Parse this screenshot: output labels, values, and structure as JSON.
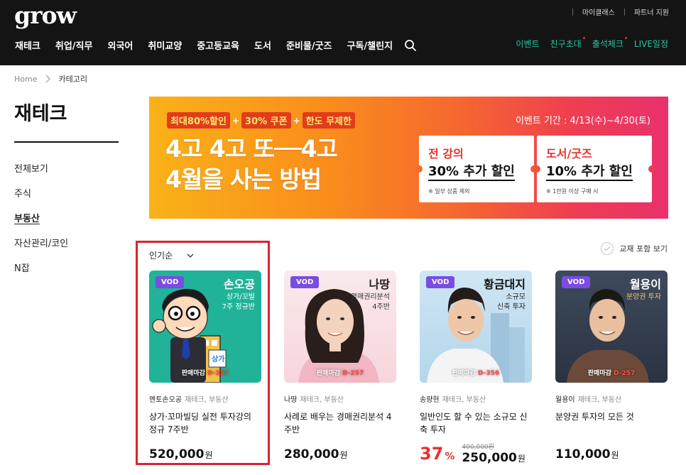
{
  "header": {
    "logo": "grow",
    "util_links": [
      "마이클래스",
      "파트너 지원"
    ],
    "nav": [
      "재테크",
      "취업/직무",
      "외국어",
      "취미교양",
      "중고등교육",
      "도서",
      "준비물/굿즈",
      "구독/챌린지"
    ],
    "nav_right": [
      "이벤트",
      "친구초대",
      "출석체크",
      "LIVE일정"
    ]
  },
  "breadcrumb": {
    "home": "Home",
    "current": "카테고리"
  },
  "sidebar": {
    "title": "재테크",
    "items": [
      {
        "label": "전체보기"
      },
      {
        "label": "주식"
      },
      {
        "label": "부동산",
        "active": true
      },
      {
        "label": "자산관리/코인"
      },
      {
        "label": "N잡"
      }
    ]
  },
  "banner": {
    "promo": [
      "최대80%할인",
      "30% 쿠폰",
      "한도 무제한"
    ],
    "headline_1": "4고 4고 또──4고",
    "headline_2": "4월을 사는 방법",
    "period": "이벤트 기간 : 4/13(수)~4/30(토)",
    "coupons": [
      {
        "title": "전 강의",
        "value": "30% 추가 할인",
        "note": "※ 일부 상품 제외"
      },
      {
        "title": "도서/굿즈",
        "value": "10% 추가 할인",
        "note": "※ 1만원 이상 구매 시"
      }
    ]
  },
  "list": {
    "sort": "인기순",
    "toggle": "교재 포함 보기",
    "cards": [
      {
        "badge": "VOD",
        "thumb_name": "손오공",
        "thumb_sub_1": "상가/꼬빌",
        "thumb_sub_2": "7주 정규반",
        "deadline": "판매마감",
        "dday": "D-257",
        "instructor": "멘토손오공",
        "category": "재테크, 부동산",
        "title": "상가·꼬마빌딩 실전 투자강의 정규 7주반",
        "price": "520,000",
        "won": "원"
      },
      {
        "badge": "VOD",
        "thumb_name": "나땅",
        "thumb_sub_1": "경매권리분석",
        "thumb_sub_2": "4주반",
        "deadline": "판매마감",
        "dday": "D-257",
        "instructor": "나땅",
        "category": "재테크, 부동산",
        "title": "사례로 배우는 경매권리분석 4주반",
        "price": "280,000",
        "won": "원"
      },
      {
        "badge": "VOD",
        "thumb_name": "황금대지",
        "thumb_sub_1": "소규모",
        "thumb_sub_2": "신축 투자",
        "deadline": "판매마감",
        "dday": "D-356",
        "instructor": "송량현",
        "category": "재테크, 부동산",
        "title": "일반인도 할 수 있는 소규모 신축 투자",
        "discount": "37",
        "pct_sign": "%",
        "original": "400,000원",
        "price": "250,000",
        "won": "원"
      },
      {
        "badge": "VOD",
        "thumb_name": "월용이",
        "thumb_sub_1": "분양권 투자",
        "deadline": "판매마감",
        "dday": "D-257",
        "instructor": "월용이",
        "category": "재테크, 부동산",
        "title": "분양권 투자의 모든 것",
        "price": "110,000",
        "won": "원"
      }
    ]
  },
  "colors": {
    "header_bg": "#141414",
    "accent_green": "#28c6a0",
    "sale_red": "#e9322d",
    "vod_purple": "#7a4ce0",
    "highlight_red": "#d9242f"
  }
}
